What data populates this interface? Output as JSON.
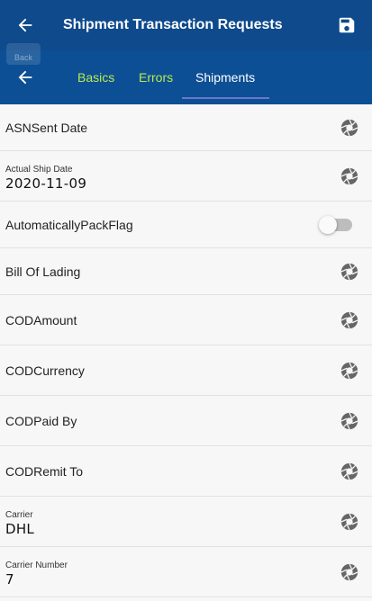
{
  "header": {
    "title": "Shipment Transaction Requests",
    "back_tooltip": "Back"
  },
  "tabs": [
    {
      "label": "Basics",
      "active": false
    },
    {
      "label": "Errors",
      "active": false
    },
    {
      "label": "Shipments",
      "active": true
    }
  ],
  "colors": {
    "titlebar": "#0e4a8c",
    "tabbar": "#0d4f95",
    "tab_inactive": "#b8ea4c",
    "tab_indicator": "#6a78c9"
  },
  "fields": [
    {
      "label": "ASNSent Date",
      "value": "",
      "control": "camera-icon"
    },
    {
      "label": "Actual Ship Date",
      "value": "2020-11-09",
      "control": "camera-icon"
    },
    {
      "label": "AutomaticallyPackFlag",
      "value": "",
      "control": "toggle",
      "toggle_on": false
    },
    {
      "label": "Bill Of Lading",
      "value": "",
      "control": "camera-icon"
    },
    {
      "label": "CODAmount",
      "value": "",
      "control": "camera-icon"
    },
    {
      "label": "CODCurrency",
      "value": "",
      "control": "camera-icon"
    },
    {
      "label": "CODPaid By",
      "value": "",
      "control": "camera-icon"
    },
    {
      "label": "CODRemit To",
      "value": "",
      "control": "camera-icon"
    },
    {
      "label": "Carrier",
      "value": "DHL",
      "control": "camera-icon"
    },
    {
      "label": "Carrier Number",
      "value": "7",
      "control": "camera-icon"
    }
  ]
}
